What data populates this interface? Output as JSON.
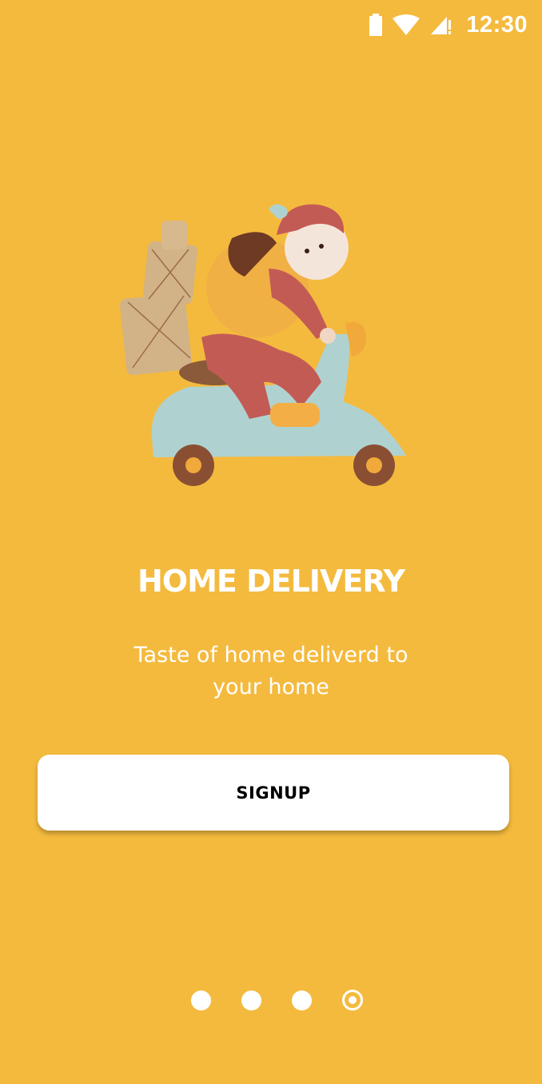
{
  "status_bar": {
    "time": "12:30",
    "icons": [
      "battery-icon",
      "wifi-icon",
      "cellular-signal-icon"
    ]
  },
  "illustration": {
    "subject": "scooter-delivery-illustration"
  },
  "onboarding": {
    "title": "HOME DELIVERY",
    "subtitle": "Taste of home deliverd to your home",
    "signup_label": "SIGNUP"
  },
  "pager": {
    "total_pages": 4,
    "current_page": 4
  },
  "colors": {
    "background": "#F4BA3E",
    "text": "#FFFFFF",
    "button_bg": "#FFFFFF",
    "button_text": "#000000"
  }
}
